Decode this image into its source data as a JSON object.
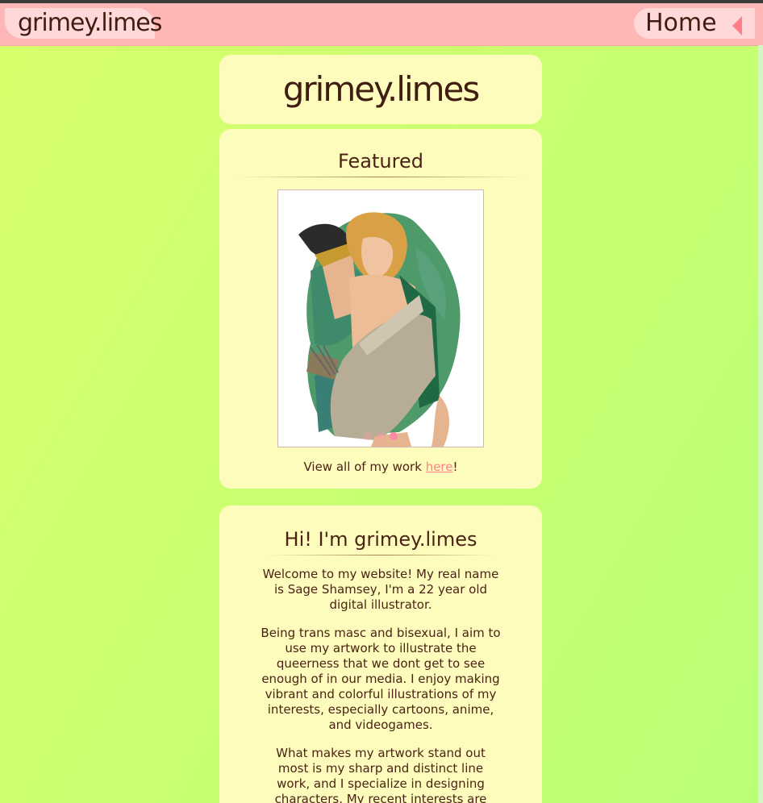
{
  "nav": {
    "brand": "grimey.limes",
    "home_label": "Home"
  },
  "header": {
    "title": "grimey.limes"
  },
  "featured": {
    "heading": "Featured",
    "carousel_dots": 3,
    "active_dot": 3,
    "view_all_prefix": "View all of my work ",
    "view_all_link": "here",
    "view_all_suffix": "!"
  },
  "about": {
    "heading": "Hi! I'm grimey.limes",
    "paragraphs": [
      "Welcome to my website! My real name is Sage Shamsey, I'm a 22 year old digital illustrator.",
      "Being trans masc and bisexual, I aim to use my artwork to illustrate the queerness that we dont get to see enough of in our media. I enjoy making vibrant and colorful illustrations of my interests, especially cartoons, anime, and videogames.",
      "What makes my artwork stand out most is my sharp and distinct line work, and I specialize in designing characters. My recent interests are Hazbin Hotel, Good"
    ]
  },
  "colors": {
    "nav_bg": "#ffb6b6",
    "card_bg": "#fefcbd",
    "accent": "#ff7f86",
    "text": "#4a2314"
  },
  "icons": {
    "home_arrow": "left-triangle-icon"
  }
}
